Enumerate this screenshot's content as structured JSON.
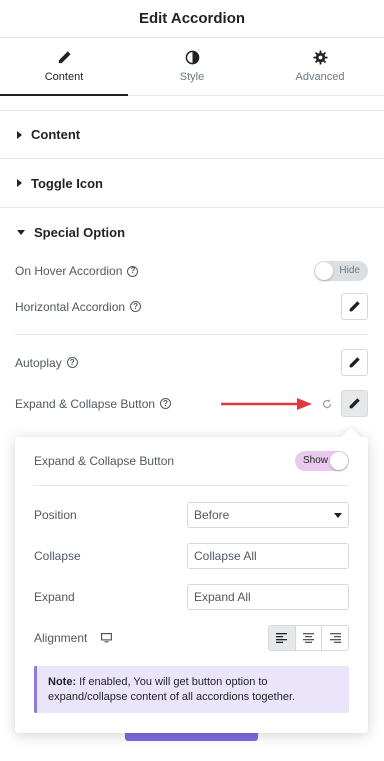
{
  "header": {
    "title": "Edit Accordion"
  },
  "tabs": [
    {
      "label": "Content",
      "icon": "pencil-icon",
      "active": true
    },
    {
      "label": "Style",
      "icon": "half-circle-icon",
      "active": false
    },
    {
      "label": "Advanced",
      "icon": "gear-icon",
      "active": false
    }
  ],
  "sections": {
    "content": "Content",
    "toggle_icon": "Toggle Icon",
    "special_option": "Special Option"
  },
  "controls": {
    "on_hover": {
      "label": "On Hover Accordion",
      "toggle_text": "Hide",
      "enabled": false
    },
    "horizontal": {
      "label": "Horizontal Accordion"
    },
    "autoplay": {
      "label": "Autoplay"
    },
    "expand_collapse": {
      "label": "Expand & Collapse Button"
    }
  },
  "popover": {
    "title": "Expand & Collapse Button",
    "toggle_text": "Show",
    "enabled": true,
    "position": {
      "label": "Position",
      "value": "Before"
    },
    "collapse": {
      "label": "Collapse",
      "value": "Collapse All"
    },
    "expand": {
      "label": "Expand",
      "value": "Expand All"
    },
    "alignment": {
      "label": "Alignment",
      "selected": "left"
    },
    "note": {
      "prefix": "Note:",
      "text": " If enabled, You will get button option to expand/collapse content of all accordions together."
    }
  },
  "colors": {
    "accent_pink": "#e9c9ee",
    "note_bg": "#eae5fb",
    "note_border": "#8e7bd8",
    "arrow_red": "#e0393e",
    "button_purple": "#7d6be3"
  }
}
